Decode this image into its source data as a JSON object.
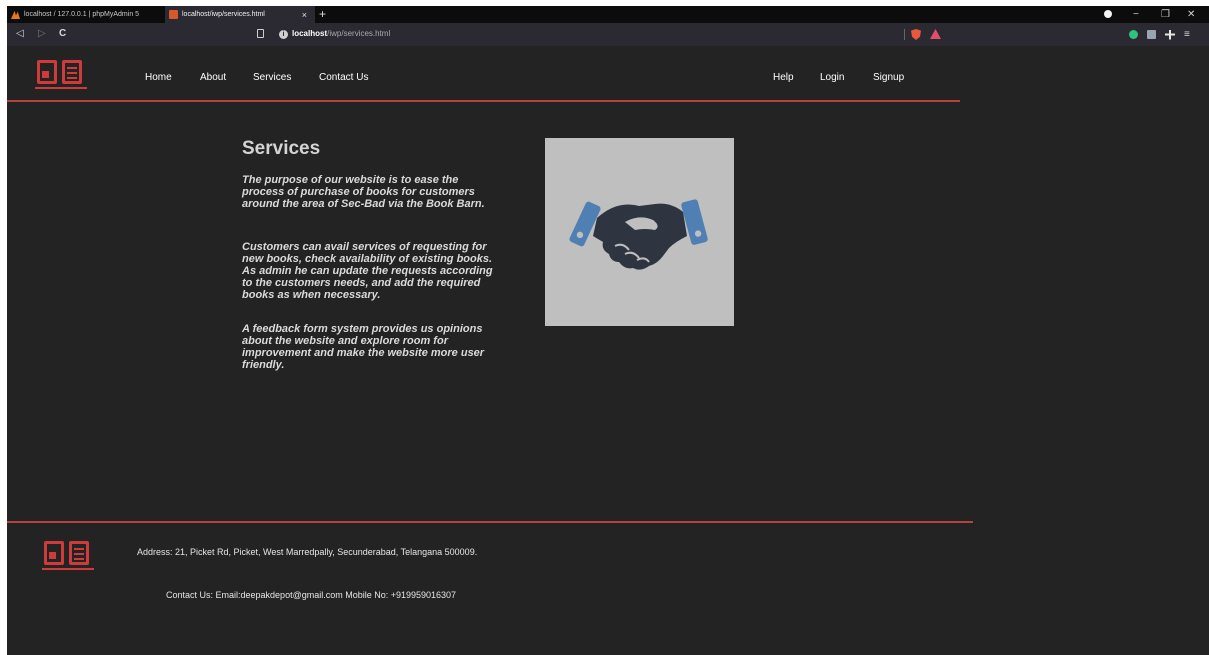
{
  "browser": {
    "tabs": [
      {
        "title": "localhost / 127.0.0.1 | phpMyAdmin 5"
      },
      {
        "title": "localhost/iwp/services.html",
        "close": "×"
      }
    ],
    "new_tab": "+",
    "window_controls": {
      "minimize": "−",
      "restore": "❐",
      "close": "✕"
    },
    "nav": {
      "back": "◁",
      "forward": "▷",
      "reload": "C"
    },
    "url": {
      "host": "localhost",
      "path": "/iwp/services.html"
    },
    "menu": "≡"
  },
  "site": {
    "nav_left": [
      "Home",
      "About",
      "Services",
      "Contact Us"
    ],
    "nav_right": [
      "Help",
      "Login",
      "Signup"
    ],
    "colors": {
      "accent": "#cf3b3b",
      "background": "#232323",
      "image_bg": "#bfbfbf"
    }
  },
  "main": {
    "title": "Services",
    "paragraphs": [
      "The purpose of our website is to ease the process of purchase of books for customers around the area of Sec-Bad via the Book Barn.",
      "Customers can avail services of requesting for new books, check availability of existing books. As admin he can update the requests according to the customers needs, and add the required books as when necessary.",
      "A feedback form system provides us opinions about the website and explore room for improvement and make the website more user friendly."
    ],
    "image_icon": "handshake-icon"
  },
  "footer": {
    "address": "Address: 21, Picket Rd, Picket, West Marredpally, Secunderabad, Telangana 500009.",
    "contact": "Contact Us: Email:deepakdepot@gmail.com Mobile No: +919959016307"
  }
}
